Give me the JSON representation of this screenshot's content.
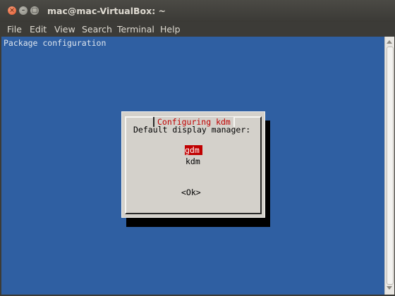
{
  "window": {
    "title": "mac@mac-VirtualBox: ~",
    "controls": {
      "close": "×",
      "minimize": "–",
      "maximize": "□"
    }
  },
  "menu": {
    "items": [
      "File",
      "Edit",
      "View",
      "Search",
      "Terminal",
      "Help"
    ]
  },
  "terminal": {
    "header_text": "Package configuration",
    "background_color": "#2f5fa2"
  },
  "dialog": {
    "title": "Configuring kdm",
    "prompt": "Default display manager:",
    "options": [
      {
        "label": "gdm",
        "selected": true
      },
      {
        "label": "kdm",
        "selected": false
      }
    ],
    "ok_button": "<Ok>",
    "highlight_color": "#c00000"
  }
}
